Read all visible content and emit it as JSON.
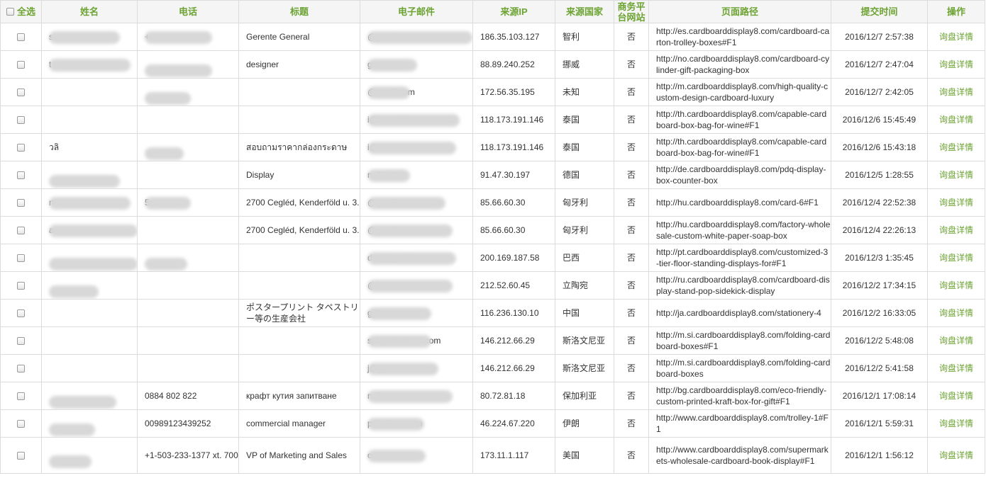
{
  "header": {
    "select_all": "全选",
    "name": "姓名",
    "phone": "电话",
    "title": "标题",
    "email": "电子邮件",
    "ip": "来源IP",
    "country": "来源国家",
    "platform": "商务平台网站",
    "path": "页面路径",
    "time": "提交时间",
    "action": "操作"
  },
  "rows": [
    {
      "name": "s",
      "phone": "+",
      "title": "Gerente General",
      "email": "@gmail.com",
      "ip": "186.35.103.127",
      "country": "智利",
      "platform": "否",
      "path": "http://es.cardboarddisplay8.com/cardboard-carton-trolley-boxes#F1",
      "time": "2016/12/7 2:57:38",
      "action": "询盘详情"
    },
    {
      "name": "t",
      "phone": "",
      "title": "designer",
      "email": "gmail.com",
      "ip": "88.89.240.252",
      "country": "挪威",
      "platform": "否",
      "path": "http://no.cardboarddisplay8.com/cardboard-cylinder-gift-packaging-box",
      "time": "2016/12/7 2:47:04",
      "action": "询盘详情"
    },
    {
      "name": "",
      "phone": "",
      "title": "",
      "email": "@gmail.com",
      "ip": "172.56.35.195",
      "country": "未知",
      "platform": "否",
      "path": "http://m.cardboarddisplay8.com/high-quality-custom-design-cardboard-luxury",
      "time": "2016/12/7 2:42:05",
      "action": "询盘详情"
    },
    {
      "name": "",
      "phone": "",
      "title": "",
      "email": "i@hotmail.com",
      "ip": "118.173.191.146",
      "country": "泰国",
      "platform": "否",
      "path": "http://th.cardboarddisplay8.com/capable-cardboard-box-bag-for-wine#F1",
      "time": "2016/12/6 15:45:49",
      "action": "询盘详情"
    },
    {
      "name": "วลิ",
      "phone": "",
      "title": "สอบถามราคากล่องกระดาษ",
      "email": "i@hotmail.com",
      "ip": "118.173.191.146",
      "country": "泰国",
      "platform": "否",
      "path": "http://th.cardboarddisplay8.com/capable-cardboard-box-bag-for-wine#F1",
      "time": "2016/12/6 15:43:18",
      "action": "询盘详情"
    },
    {
      "name": "",
      "phone": "",
      "title": "Display",
      "email": "ns24.de",
      "ip": "91.47.30.197",
      "country": "德国",
      "platform": "否",
      "path": "http://de.cardboarddisplay8.com/pdq-display-box-counter-box",
      "time": "2016/12/5 1:28:55",
      "action": "询盘详情"
    },
    {
      "name": "rt a",
      "phone": "5",
      "title": "2700 Cegléd, Kenderföld u. 3.",
      "email": "@gmail.com",
      "ip": "85.66.60.30",
      "country": "匈牙利",
      "platform": "否",
      "path": "http://hu.cardboarddisplay8.com/card-6#F1",
      "time": "2016/12/4 22:52:38",
      "action": "询盘详情"
    },
    {
      "name": "a",
      "phone": "",
      "title": "2700 Cegléd, Kenderföld u. 3.",
      "email": "@gmail.com",
      "ip": "85.66.60.30",
      "country": "匈牙利",
      "platform": "否",
      "path": "http://hu.cardboarddisplay8.com/factory-wholesale-custom-white-paper-soap-box",
      "time": "2016/12/4 22:26:13",
      "action": "询盘详情"
    },
    {
      "name": "",
      "phone": "",
      "title": "",
      "email": "des@gmail.com",
      "ip": "200.169.187.58",
      "country": "巴西",
      "platform": "否",
      "path": "http://pt.cardboarddisplay8.com/customized-3-tier-floor-standing-displays-for#F1",
      "time": "2016/12/3 1:35:45",
      "action": "询盘详情"
    },
    {
      "name": "",
      "phone": "",
      "title": "",
      "email": "@lt.nestle.com",
      "ip": "212.52.60.45",
      "country": "立陶宛",
      "platform": "否",
      "path": "http://ru.cardboarddisplay8.com/cardboard-display-stand-pop-sidekick-display",
      "time": "2016/12/2 17:34:15",
      "action": "询盘详情"
    },
    {
      "name": "",
      "phone": "",
      "title": "ポスタープリント タペストリー等の生産会社",
      "email": "gjie.com",
      "ip": "116.236.130.10",
      "country": "中国",
      "platform": "否",
      "path": "http://ja.cardboarddisplay8.com/stationery-4",
      "time": "2016/12/2 16:33:05",
      "action": "询盘详情"
    },
    {
      "name": "",
      "phone": "",
      "title": "",
      "email": "splaystandpop.com",
      "ip": "146.212.66.29",
      "country": "斯洛文尼亚",
      "platform": "否",
      "path": "http://m.si.cardboarddisplay8.com/folding-cardboard-boxes#F1",
      "time": "2016/12/2 5:48:08",
      "action": "询盘详情"
    },
    {
      "name": "",
      "phone": "",
      "title": "",
      "email": "j@gmail.com",
      "ip": "146.212.66.29",
      "country": "斯洛文尼亚",
      "platform": "否",
      "path": "http://m.si.cardboarddisplay8.com/folding-cardboard-boxes",
      "time": "2016/12/2 5:41:58",
      "action": "询盘详情"
    },
    {
      "name": "",
      "phone": "0884 802 822",
      "title": "крафт кутия запитване",
      "email": "nail.com",
      "ip": "80.72.81.18",
      "country": "保加利亚",
      "platform": "否",
      "path": "http://bg.cardboarddisplay8.com/eco-friendly-custom-printed-kraft-box-for-gift#F1",
      "time": "2016/12/1 17:08:14",
      "action": "询盘详情"
    },
    {
      "name": "",
      "phone": "00989123439252",
      "title": "commercial manager",
      "email": "p@yahoo.com",
      "ip": "46.224.67.220",
      "country": "伊朗",
      "platform": "否",
      "path": "http://www.cardboarddisplay8.com/trolley-1#F1",
      "time": "2016/12/1 5:59:31",
      "action": "询盘详情"
    },
    {
      "name": "",
      "phone": "+1-503-233-1377 xt. 700",
      "title": "VP of Marketing and Sales",
      "email": "onipress.com",
      "ip": "173.11.1.117",
      "country": "美国",
      "platform": "否",
      "path": "http://www.cardboarddisplay8.com/supermarkets-wholesale-cardboard-book-display#F1",
      "time": "2016/12/1 1:56:12",
      "action": "询盘详情"
    }
  ],
  "colors": {
    "accent": "#6ca332",
    "header_bg": "#f5f5f5",
    "border": "#dcdcdc",
    "redaction": "#dcdcdc"
  }
}
